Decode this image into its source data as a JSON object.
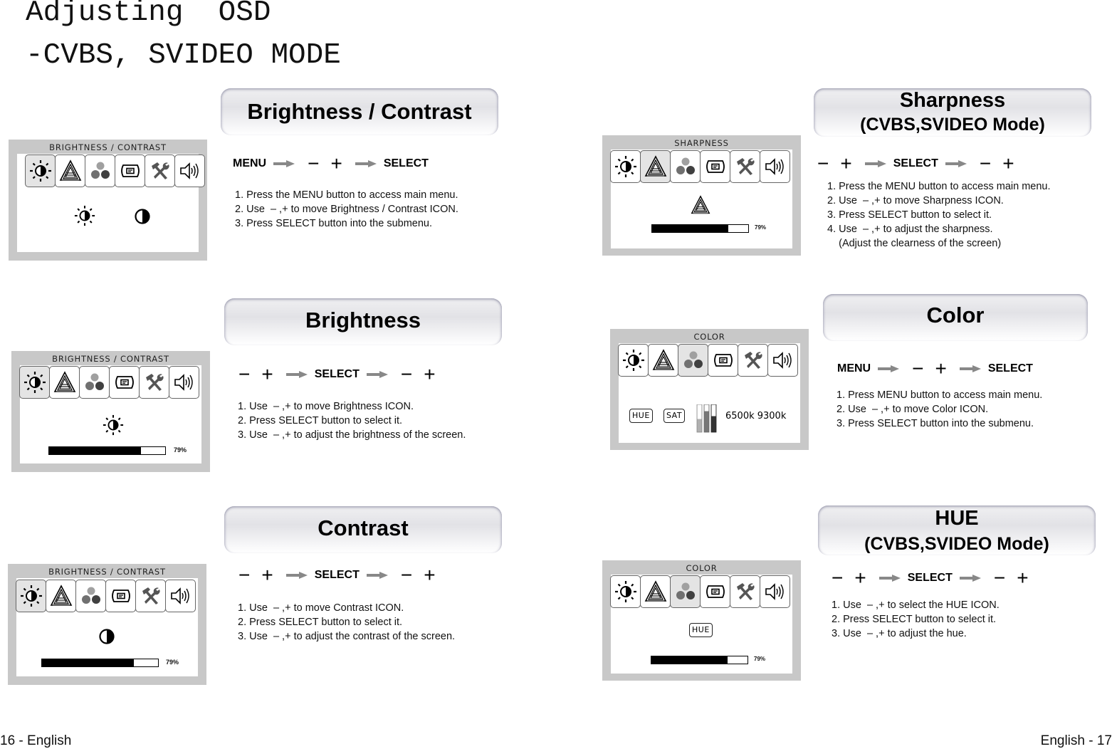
{
  "page": {
    "title": "Adjusting  OSD",
    "subtitle": "-CVBS, SVIDEO MODE",
    "footer_left": "16 - English",
    "footer_right": "English - 17"
  },
  "osd_tabs": [
    {
      "icon": "brightness-contrast-icon"
    },
    {
      "icon": "sharpness-icon"
    },
    {
      "icon": "color-icon"
    },
    {
      "icon": "osd-position-icon"
    },
    {
      "icon": "tools-icon"
    },
    {
      "icon": "speaker-icon"
    }
  ],
  "colors": {
    "panel_bg": "#c8c8c8",
    "active_tab": "#e4e4e4",
    "arrow": "#888888",
    "color_dot_top": "#a0a0a0",
    "color_dot_left": "#707070",
    "color_dot_right": "#404040"
  },
  "sections": {
    "brightness_contrast": {
      "banner": [
        "Brightness / Contrast"
      ],
      "osd_title": "BRIGHTNESS / CONTRAST",
      "active_tab": 0,
      "flow": [
        "MENU",
        "arrow",
        "−",
        "+",
        "arrow",
        "SELECT"
      ],
      "steps": [
        "1. Press the MENU button to access main menu.",
        "2. Use  – ,+ to move Brightness / Contrast ICON.",
        "3. Press SELECT button into the submenu."
      ]
    },
    "brightness": {
      "banner": [
        "Brightness"
      ],
      "osd_title": "BRIGHTNESS / CONTRAST",
      "active_tab": 0,
      "value_percent": 79,
      "value_label": "79%",
      "flow": [
        "−",
        "+",
        "arrow",
        "SELECT",
        "arrow",
        "−",
        "+"
      ],
      "steps": [
        "1. Use  – ,+ to move Brightness ICON.",
        "2. Press SELECT button to select it.",
        "3. Use  – ,+ to adjust the brightness of the screen."
      ]
    },
    "contrast": {
      "banner": [
        "Contrast"
      ],
      "osd_title": "BRIGHTNESS / CONTRAST",
      "active_tab": 0,
      "value_percent": 79,
      "value_label": "79%",
      "flow": [
        "−",
        "+",
        "arrow",
        "SELECT",
        "arrow",
        "−",
        "+"
      ],
      "steps": [
        "1. Use  – ,+ to move Contrast ICON.",
        "2. Press SELECT button to select it.",
        "3. Use  – ,+ to adjust the contrast of the screen."
      ]
    },
    "sharpness": {
      "banner": [
        "Sharpness",
        "(CVBS,SVIDEO Mode)"
      ],
      "osd_title": "SHARPNESS",
      "active_tab": 1,
      "value_percent": 79,
      "value_label": "79%",
      "flow": [
        "−",
        "+",
        "arrow",
        "SELECT",
        "arrow",
        "−",
        "+"
      ],
      "steps": [
        "1. Press the MENU button to access main menu.",
        "2. Use  – ,+ to move Sharpness ICON.",
        "3. Press SELECT button to select it.",
        "4. Use  – ,+ to adjust the sharpness.",
        "    (Adjust the clearness of the screen)"
      ]
    },
    "color": {
      "banner": [
        "Color"
      ],
      "osd_title": "COLOR",
      "active_tab": 2,
      "submenu": {
        "hue": "HUE",
        "sat": "SAT",
        "temp": "6500k 9300k"
      },
      "flow": [
        "MENU",
        "arrow",
        "−",
        "+",
        "arrow",
        "SELECT"
      ],
      "steps": [
        "1. Press MENU button to access main menu.",
        "2. Use  – ,+ to move Color ICON.",
        "3. Press SELECT button into the submenu."
      ]
    },
    "hue": {
      "banner": [
        "HUE",
        "(CVBS,SVIDEO Mode)"
      ],
      "osd_title": "COLOR",
      "active_tab": 2,
      "hue_label": "HUE",
      "value_percent": 79,
      "value_label": "79%",
      "flow": [
        "−",
        "+",
        "arrow",
        "SELECT",
        "arrow",
        "−",
        "+"
      ],
      "steps": [
        "1. Use  – ,+ to select the HUE ICON.",
        "2. Press SELECT button to select it.",
        "3. Use  – ,+ to adjust the hue."
      ]
    }
  }
}
